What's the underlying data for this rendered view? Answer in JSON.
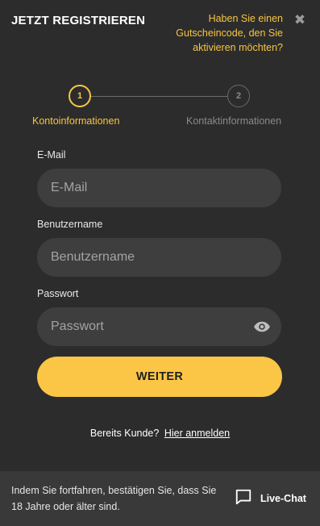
{
  "header": {
    "title": "JETZT REGISTRIEREN",
    "promo_link": "Haben Sie einen Gutscheincode, den Sie aktivieren möchten?",
    "close_icon": "close-icon"
  },
  "stepper": {
    "steps": [
      {
        "number": "1",
        "label": "Kontoinformationen",
        "active": true
      },
      {
        "number": "2",
        "label": "Kontaktinformationen",
        "active": false
      }
    ]
  },
  "form": {
    "email": {
      "label": "E-Mail",
      "placeholder": "E-Mail",
      "value": ""
    },
    "username": {
      "label": "Benutzername",
      "placeholder": "Benutzername",
      "value": ""
    },
    "password": {
      "label": "Passwort",
      "placeholder": "Passwort",
      "value": "",
      "toggle_icon": "eye-icon"
    },
    "submit_label": "WEITER"
  },
  "login": {
    "prompt": "Bereits Kunde?",
    "link": "Hier anmelden"
  },
  "footer": {
    "notice": "Indem Sie fortfahren, bestätigen Sie, dass Sie 18 Jahre oder älter sind.",
    "chat_label": "Live-Chat",
    "chat_icon": "chat-bubble-icon"
  },
  "colors": {
    "background": "#2c2c2c",
    "accent": "#fbc645",
    "input_background": "#3e3e3e",
    "footer_background": "#393939"
  }
}
